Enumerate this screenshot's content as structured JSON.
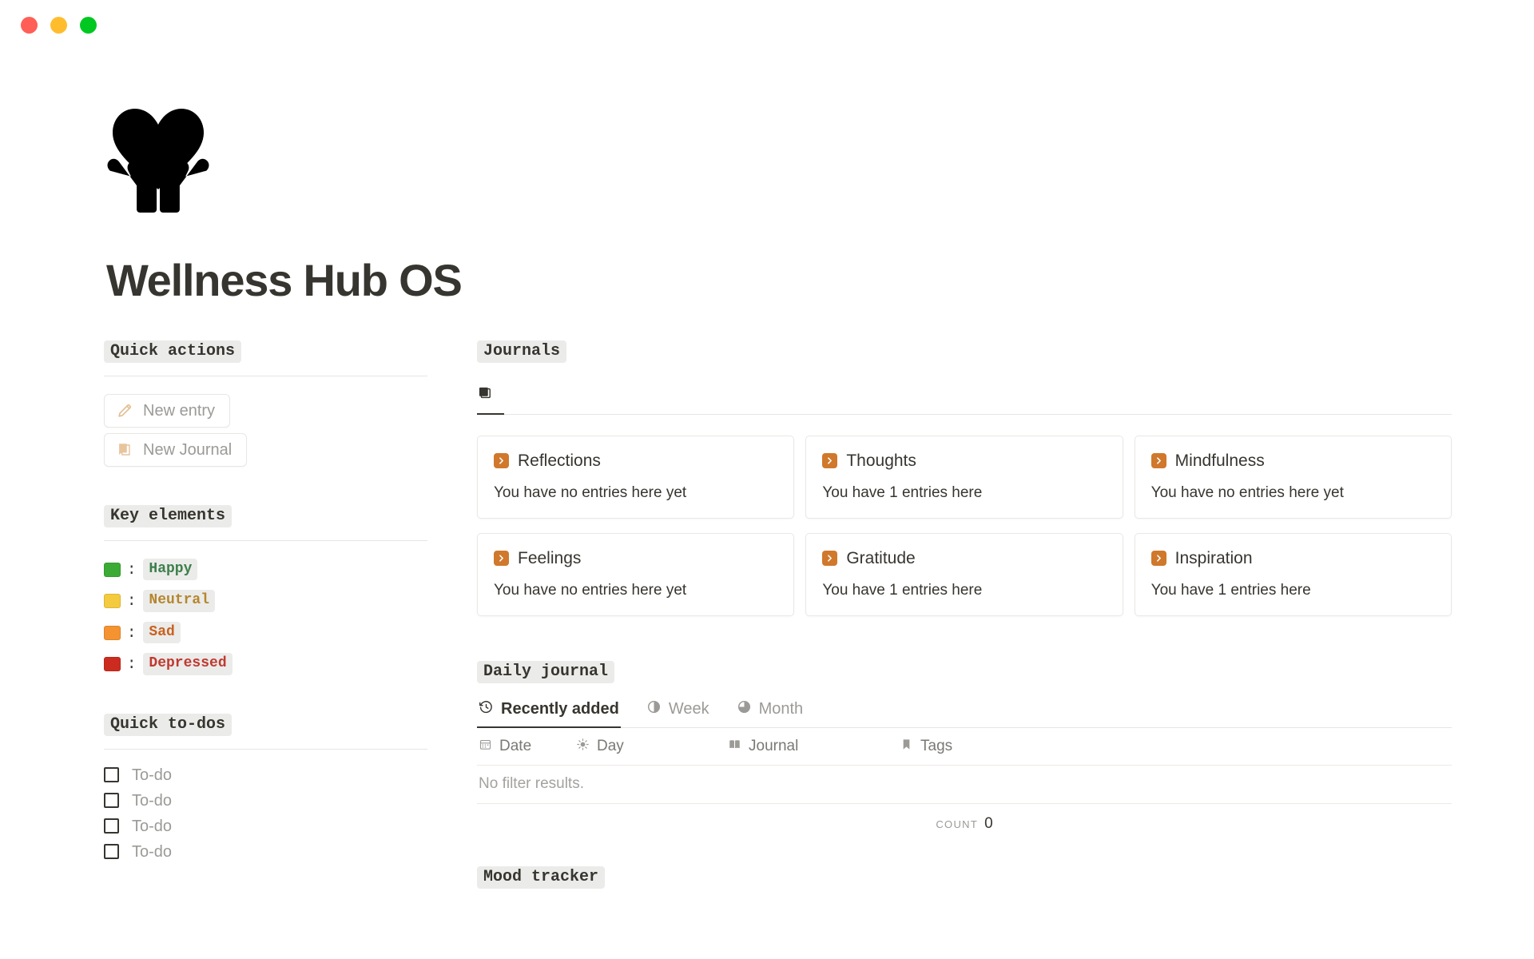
{
  "window": {
    "traffic_lights": [
      {
        "name": "close",
        "color": "#ff5f57"
      },
      {
        "name": "minimize",
        "color": "#ffbd2e"
      },
      {
        "name": "maximize",
        "color": "#00c821"
      }
    ]
  },
  "hero": {
    "logo_icon": "heart-in-hands-icon",
    "title": "Wellness Hub OS"
  },
  "sidebar": {
    "quick_actions": {
      "heading": "Quick actions",
      "buttons": [
        {
          "label": "New entry",
          "icon": "pencil-icon"
        },
        {
          "label": "New Journal",
          "icon": "notebook-icon"
        }
      ]
    },
    "key_elements": {
      "heading": "Key elements",
      "separator": ":",
      "items": [
        {
          "label": "Happy",
          "swatch": "#3bab36",
          "text_color": "#3d7f4a"
        },
        {
          "label": "Neutral",
          "swatch": "#f4cb3e",
          "text_color": "#b5862c"
        },
        {
          "label": "Sad",
          "swatch": "#f59331",
          "text_color": "#c9611d"
        },
        {
          "label": "Depressed",
          "swatch": "#cc2c20",
          "text_color": "#c0392f"
        }
      ]
    },
    "quick_todos": {
      "heading": "Quick to-dos",
      "items": [
        {
          "label": "To-do",
          "checked": false
        },
        {
          "label": "To-do",
          "checked": false
        },
        {
          "label": "To-do",
          "checked": false
        },
        {
          "label": "To-do",
          "checked": false
        }
      ]
    }
  },
  "journals": {
    "heading": "Journals",
    "tabs": [
      {
        "label": "",
        "icon": "stacked-notebook-icon",
        "active": true
      }
    ],
    "cards": [
      {
        "title": "Reflections",
        "subtitle": "You have no entries here yet",
        "icon": "orange-chevron-icon"
      },
      {
        "title": "Thoughts",
        "subtitle": "You have 1 entries here",
        "icon": "orange-chevron-icon"
      },
      {
        "title": "Mindfulness",
        "subtitle": "You have no entries here yet",
        "icon": "orange-chevron-icon"
      },
      {
        "title": "Feelings",
        "subtitle": "You have no entries here yet",
        "icon": "orange-chevron-icon"
      },
      {
        "title": "Gratitude",
        "subtitle": "You have 1 entries here",
        "icon": "orange-chevron-icon"
      },
      {
        "title": "Inspiration",
        "subtitle": "You have 1 entries here",
        "icon": "orange-chevron-icon"
      }
    ],
    "accent_color": "#d0782c"
  },
  "daily_journal": {
    "heading": "Daily journal",
    "tabs": [
      {
        "label": "Recently added",
        "icon": "clock-rewind-icon",
        "active": true
      },
      {
        "label": "Week",
        "icon": "half-circle-icon",
        "active": false
      },
      {
        "label": "Month",
        "icon": "three-quarter-circle-icon",
        "active": false
      }
    ],
    "table": {
      "columns": [
        {
          "label": "Date",
          "icon": "calendar-icon"
        },
        {
          "label": "Day",
          "icon": "sun-icon"
        },
        {
          "label": "Journal",
          "icon": "open-book-icon"
        },
        {
          "label": "Tags",
          "icon": "bookmark-icon"
        }
      ],
      "rows": [],
      "empty_text": "No filter results.",
      "count_label": "COUNT",
      "count_value": "0"
    }
  },
  "mood_tracker": {
    "heading": "Mood tracker"
  }
}
